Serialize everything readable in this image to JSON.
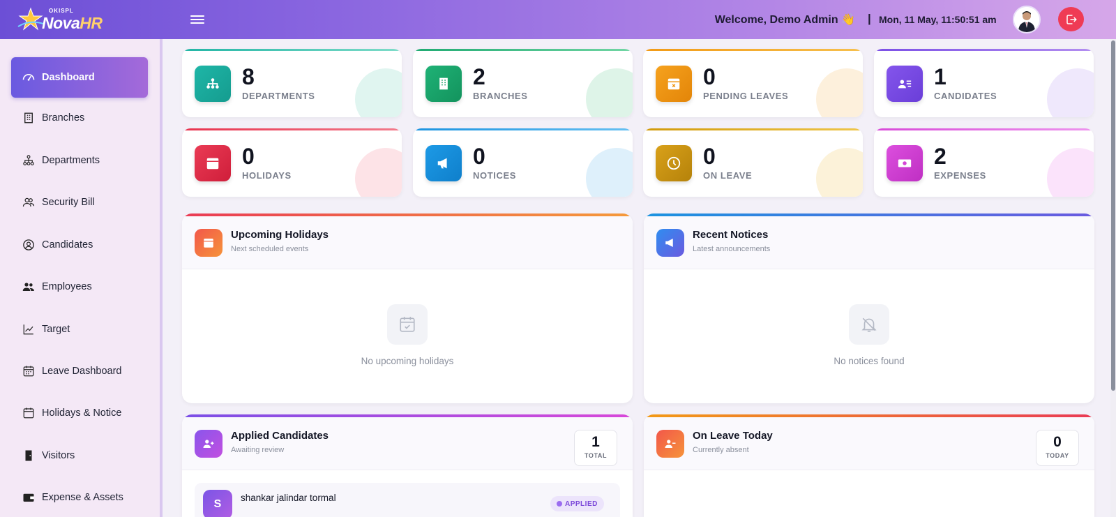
{
  "app": {
    "logo_small": "OKISPL",
    "logo_main": "Nova",
    "logo_accent": "HR"
  },
  "header": {
    "welcome": "Welcome, Demo Admin 👋",
    "separator": "|",
    "datetime": "Mon, 11 May, 11:50:51 am"
  },
  "sidebar": {
    "items": [
      {
        "label": "Dashboard",
        "icon": "gauge-icon",
        "active": true
      },
      {
        "label": "Branches",
        "icon": "building-icon"
      },
      {
        "label": "Departments",
        "icon": "sitemap-icon"
      },
      {
        "label": "Security Bill",
        "icon": "users-icon"
      },
      {
        "label": "Candidates",
        "icon": "user-circle-icon"
      },
      {
        "label": "Employees",
        "icon": "user-group-icon"
      },
      {
        "label": "Target",
        "icon": "trend-icon"
      },
      {
        "label": "Leave Dashboard",
        "icon": "calendar-grid-icon"
      },
      {
        "label": "Holidays & Notice",
        "icon": "calendar-icon"
      },
      {
        "label": "Visitors",
        "icon": "door-icon"
      },
      {
        "label": "Expense & Assets",
        "icon": "wallet-icon"
      }
    ]
  },
  "stats": [
    {
      "value": "8",
      "label": "DEPARTMENTS",
      "color": "#1fb5a8"
    },
    {
      "value": "2",
      "label": "BRANCHES",
      "color": "#1faa72"
    },
    {
      "value": "0",
      "label": "PENDING LEAVES",
      "color": "#f29a16"
    },
    {
      "value": "1",
      "label": "CANDIDATES",
      "color": "#7b4fe6"
    },
    {
      "value": "0",
      "label": "HOLIDAYS",
      "color": "#e8324e"
    },
    {
      "value": "0",
      "label": "NOTICES",
      "color": "#1b93e0"
    },
    {
      "value": "0",
      "label": "ON LEAVE",
      "color": "#d19a0a"
    },
    {
      "value": "2",
      "label": "EXPENSES",
      "color": "#d848d9"
    }
  ],
  "panels": {
    "holidays": {
      "title": "Upcoming Holidays",
      "subtitle": "Next scheduled events",
      "empty": "No upcoming holidays"
    },
    "notices": {
      "title": "Recent Notices",
      "subtitle": "Latest announcements",
      "empty": "No notices found"
    },
    "candidates": {
      "title": "Applied Candidates",
      "subtitle": "Awaiting review",
      "count": "1",
      "count_label": "TOTAL",
      "items": [
        {
          "initial": "S",
          "name": "shankar jalindar tormal",
          "status": "APPLIED"
        }
      ]
    },
    "onleave": {
      "title": "On Leave Today",
      "subtitle": "Currently absent",
      "count": "0",
      "count_label": "TODAY"
    }
  }
}
